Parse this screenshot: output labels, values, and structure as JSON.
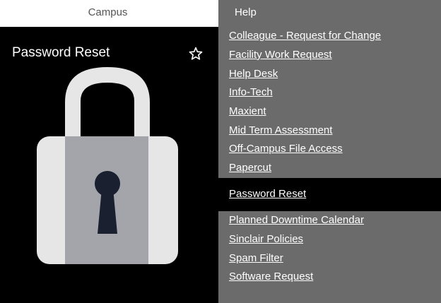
{
  "nav": {
    "campus_label": "Campus",
    "help_label": "Help"
  },
  "tile": {
    "title": "Password Reset",
    "favorite_icon": "star-outline-icon",
    "image_icon": "padlock-icon"
  },
  "help_menu": {
    "items": [
      {
        "label": "Colleague - Request for Change"
      },
      {
        "label": "Facility Work Request"
      },
      {
        "label": "Help Desk"
      },
      {
        "label": "Info-Tech"
      },
      {
        "label": "Maxient"
      },
      {
        "label": "Mid Term Assessment"
      },
      {
        "label": "Off-Campus File Access"
      },
      {
        "label": "Papercut"
      },
      {
        "label": "Password Reset",
        "active": true
      },
      {
        "label": "Planned Downtime Calendar"
      },
      {
        "label": "Sinclair Policies"
      },
      {
        "label": "Spam Filter"
      },
      {
        "label": "Software Request"
      }
    ]
  },
  "colors": {
    "menu_background": "#6b6b6b",
    "active_item_background": "#000000",
    "tile_background": "#000000",
    "accent_red": "#b0141a"
  }
}
